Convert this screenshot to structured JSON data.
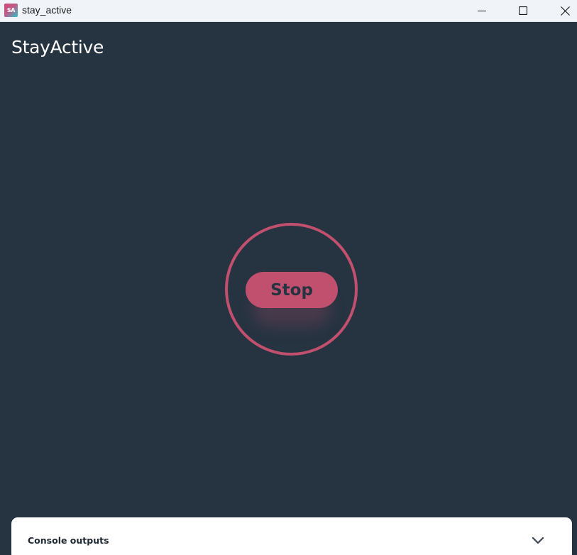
{
  "window": {
    "title": "stay_active",
    "icon_text": "SA",
    "icon": "app-icon",
    "controls": [
      "minimize-icon",
      "maximize-icon",
      "close-icon"
    ]
  },
  "app": {
    "title": "StayActive"
  },
  "main": {
    "stop_label": "Stop"
  },
  "console": {
    "label": "Console outputs",
    "icon": "chevron-down-icon"
  },
  "colors": {
    "background": "#263341",
    "accent": "#c0506d",
    "titlebar": "#f0f4f9",
    "panel": "#ffffff"
  }
}
